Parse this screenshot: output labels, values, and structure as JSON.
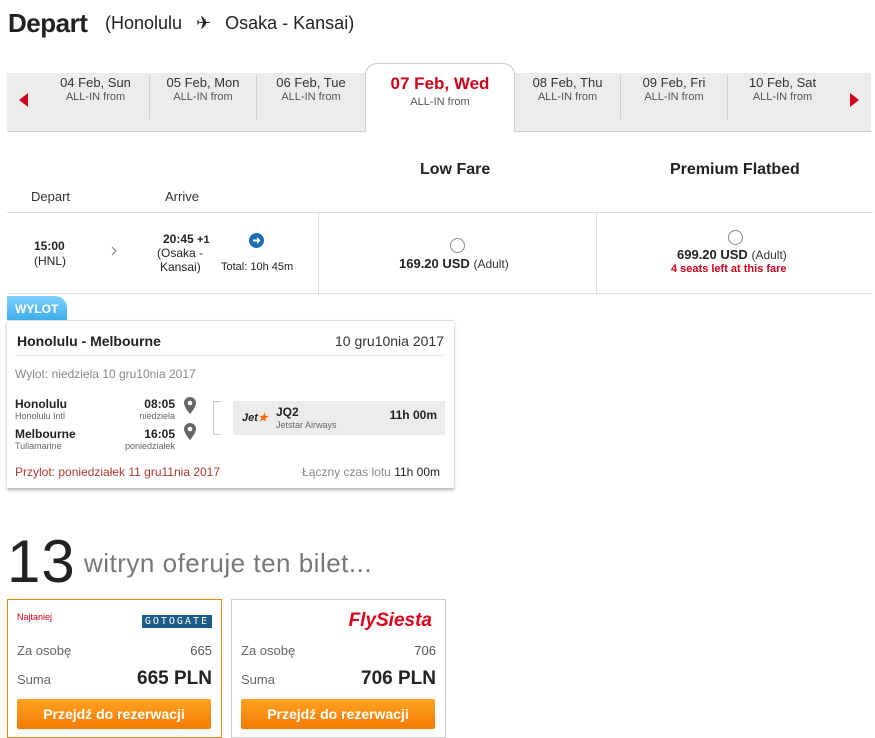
{
  "header": {
    "title": "Depart",
    "route_open": "(Honolulu",
    "route_dest": "Osaka - Kansai)",
    "plane_icon": "✈"
  },
  "dates": [
    {
      "label": "04 Feb, Sun",
      "sub": "ALL-IN from"
    },
    {
      "label": "05 Feb, Mon",
      "sub": "ALL-IN from"
    },
    {
      "label": "06 Feb, Tue",
      "sub": "ALL-IN from"
    },
    {
      "label": "07 Feb, Wed",
      "sub": "ALL-IN from"
    },
    {
      "label": "08 Feb, Thu",
      "sub": "ALL-IN from"
    },
    {
      "label": "09 Feb, Fri",
      "sub": "ALL-IN from"
    },
    {
      "label": "10 Feb, Sat",
      "sub": "ALL-IN from"
    }
  ],
  "date_selected_index": 3,
  "fare_table": {
    "col_low": "Low Fare",
    "col_premium": "Premium Flatbed",
    "head_depart": "Depart",
    "head_arrive": "Arrive",
    "depart_time": "15:00",
    "depart_code": "(HNL)",
    "arrive_time": "20:45",
    "arrive_plus": "+1",
    "arrive_place_1": "(Osaka -",
    "arrive_place_2": "Kansai)",
    "total": "Total: 10h 45m",
    "low_price": "169.20 USD",
    "low_adult": "(Adult)",
    "prem_price": "699.20 USD",
    "prem_adult": "(Adult)",
    "prem_seats": "4 seats left at this fare"
  },
  "wylot": {
    "tab": "WYLOT",
    "route": "Honolulu - Melbourne",
    "date": "10 gru10nia 2017",
    "departure_line": "Wylot: niedziela 10 gru10nia 2017",
    "from_city": "Honolulu",
    "from_airport": "Honolulu Intl",
    "from_time": "08:05",
    "from_day": "niedziela",
    "to_city": "Melbourne",
    "to_airport": "Tullamarine",
    "to_time": "16:05",
    "to_day": "poniedziałek",
    "airline_logo": "Jet",
    "flight_no": "JQ2",
    "airline": "Jetstar Airways",
    "duration": "11h 00m",
    "arrival_line": "Przylot: poniedziałek 11 gru11nia 2017",
    "total_label": "Łączny czas lotu",
    "total_value": "11h 00m"
  },
  "offers": {
    "count": "13",
    "text": "witryn oferuje ten bilet...",
    "items": [
      {
        "tag": "Najtaniej",
        "brand": "GOTOGATE",
        "per_person_label": "Za osobę",
        "per_person": "665",
        "sum_label": "Suma",
        "sum": "665 PLN",
        "button": "Przejdź do rezerwacji"
      },
      {
        "tag": "",
        "brand": "FlySiesta",
        "per_person_label": "Za osobę",
        "per_person": "706",
        "sum_label": "Suma",
        "sum": "706 PLN",
        "button": "Przejdź do rezerwacji"
      }
    ]
  },
  "colors": {
    "accent_red": "#d0021b",
    "wylot_blue": "#3daeea",
    "orange": "#f47b00",
    "gotogate_blue": "#1a5d8a",
    "jetstar_orange": "#ff6600"
  }
}
